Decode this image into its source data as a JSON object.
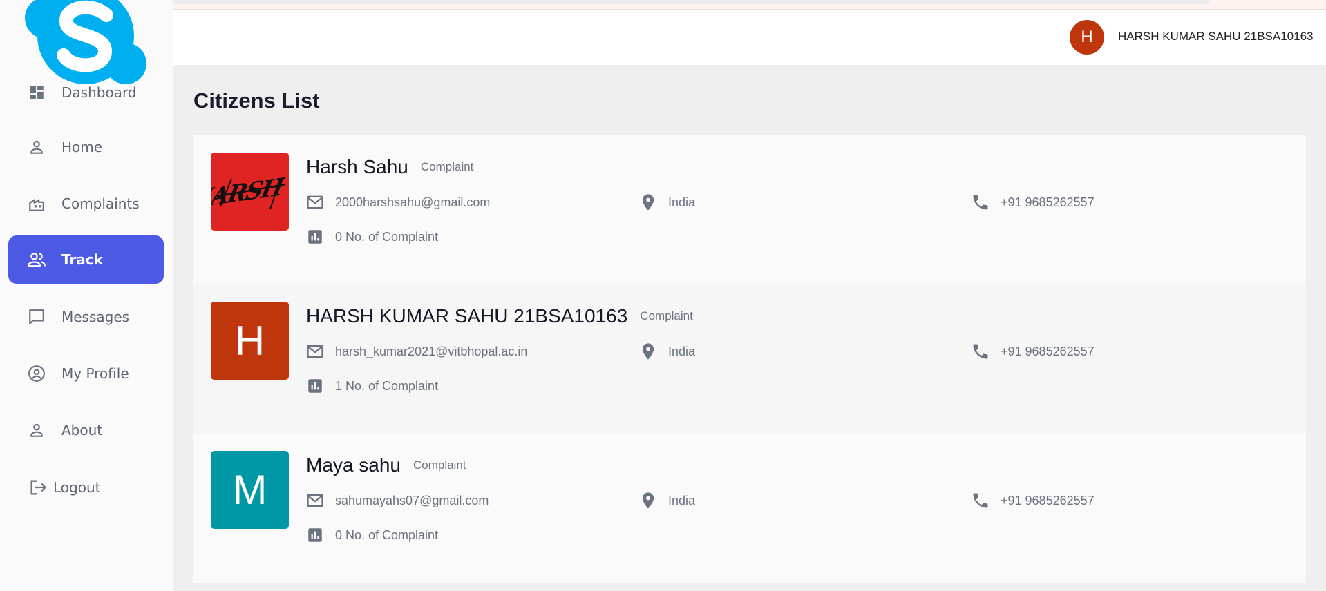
{
  "sidebar": {
    "items": [
      {
        "label": "Dashboard",
        "icon": "dashboard-icon"
      },
      {
        "label": "Home",
        "icon": "person-icon"
      },
      {
        "label": "Complaints",
        "icon": "building-icon"
      },
      {
        "label": "Track",
        "icon": "group-icon"
      },
      {
        "label": "Messages",
        "icon": "chat-icon"
      },
      {
        "label": "My Profile",
        "icon": "account-circle-icon"
      },
      {
        "label": "About",
        "icon": "person-icon"
      },
      {
        "label": "Logout",
        "icon": "logout-icon"
      }
    ],
    "active_item": "Track"
  },
  "header": {
    "avatar_initial": "H",
    "user_name": "HARSH KUMAR SAHU 21BSA10163"
  },
  "main": {
    "title": "Citizens List",
    "citizens": [
      {
        "avatar_text": "HARSH",
        "avatar_color": "#e02424",
        "name": "Harsh Sahu",
        "tag": "Complaint",
        "email": "2000harshsahu@gmail.com",
        "location": "India",
        "phone": "+91 9685262557",
        "complaints": "0 No. of Complaint"
      },
      {
        "avatar_text": "H",
        "avatar_color": "#bf360c",
        "name": "HARSH KUMAR SAHU 21BSA10163",
        "tag": "Complaint",
        "email": "harsh_kumar2021@vitbhopal.ac.in",
        "location": "India",
        "phone": "+91 9685262557",
        "complaints": "1 No. of Complaint"
      },
      {
        "avatar_text": "M",
        "avatar_color": "#0097a7",
        "name": "Maya sahu",
        "tag": "Complaint",
        "email": "sahumayahs07@gmail.com",
        "location": "India",
        "phone": "+91 9685262557",
        "complaints": "0 No. of Complaint"
      }
    ]
  },
  "colors": {
    "accent": "#4c5ae6",
    "skype_blue": "#00aff0"
  }
}
